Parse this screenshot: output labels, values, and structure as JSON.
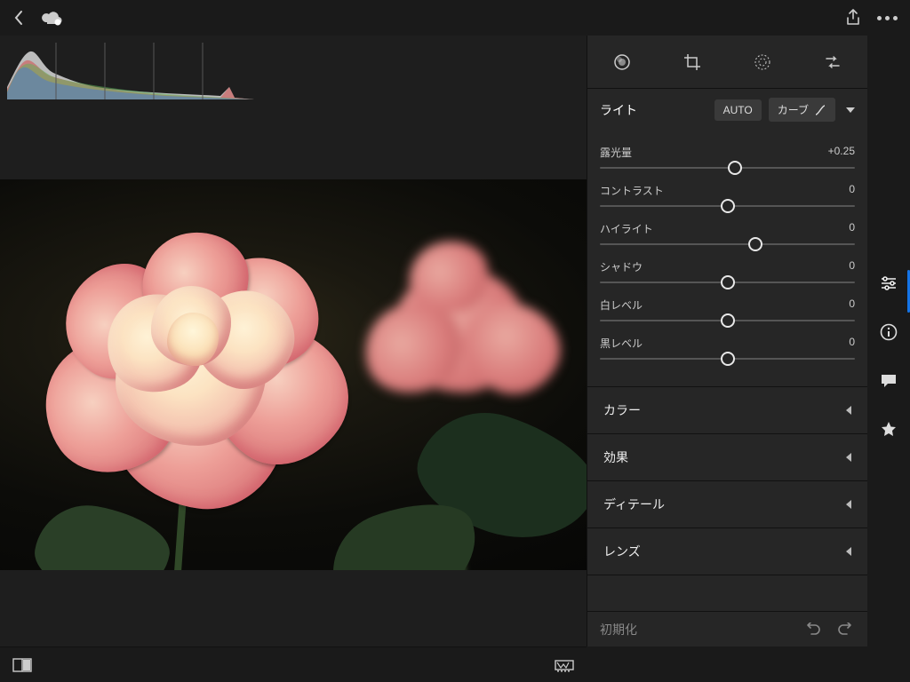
{
  "topbar": {
    "back_icon": "back",
    "cloud_icon": "cloud-sync",
    "share_icon": "share",
    "more_icon": "more"
  },
  "mode_tabs": [
    "color-wheel",
    "crop",
    "radial",
    "preset"
  ],
  "panel": {
    "light": {
      "title": "ライト",
      "auto_label": "AUTO",
      "curve_label": "カーブ",
      "sliders": [
        {
          "label": "露光量",
          "value_text": "+0.25",
          "pos": 0.53
        },
        {
          "label": "コントラスト",
          "value_text": "0",
          "pos": 0.5
        },
        {
          "label": "ハイライト",
          "value_text": "0",
          "pos": 0.61
        },
        {
          "label": "シャドウ",
          "value_text": "0",
          "pos": 0.5
        },
        {
          "label": "白レベル",
          "value_text": "0",
          "pos": 0.5
        },
        {
          "label": "黒レベル",
          "value_text": "0",
          "pos": 0.5
        }
      ]
    },
    "collapsed": [
      {
        "label": "カラー"
      },
      {
        "label": "効果"
      },
      {
        "label": "ディテール"
      },
      {
        "label": "レンズ"
      }
    ],
    "reset_label": "初期化"
  },
  "rail_icons": [
    "sliders",
    "info",
    "comment",
    "star"
  ],
  "bottombar": {
    "compare_icon": "compare",
    "filmstrip_icon": "filmstrip"
  }
}
